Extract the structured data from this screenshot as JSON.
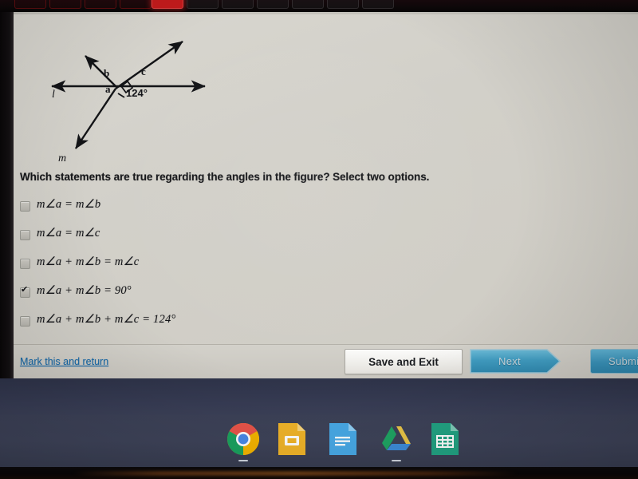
{
  "figure": {
    "name": "angle-figure",
    "line_labels": {
      "horizontal": "l",
      "diagonal": "m"
    },
    "angle_labels": {
      "a": "a",
      "b": "b",
      "c": "c"
    },
    "given_angle": "124°",
    "right_angle_marker": "right-angle-square"
  },
  "question": {
    "prefix": "Which statements are true regarding the angles in the figure? Select ",
    "emphasis": "two",
    "suffix": " options."
  },
  "options": [
    {
      "id": "opt-1",
      "label": "m∠a = m∠b",
      "checked": false
    },
    {
      "id": "opt-2",
      "label": "m∠a = m∠c",
      "checked": false
    },
    {
      "id": "opt-3",
      "label": "m∠a + m∠b = m∠c",
      "checked": false
    },
    {
      "id": "opt-4",
      "label": "m∠a + m∠b = 90°",
      "checked": true
    },
    {
      "id": "opt-5",
      "label": "m∠a + m∠b + m∠c = 124°",
      "checked": false
    }
  ],
  "actionbar": {
    "mark_link": "Mark this and return",
    "save_label": "Save and Exit",
    "next_label": "Next",
    "submit_label": "Submit"
  },
  "shelf": {
    "icons": [
      {
        "name": "chrome-icon",
        "label": "Chrome"
      },
      {
        "name": "google-slides-icon",
        "label": "Slides"
      },
      {
        "name": "google-docs-icon",
        "label": "Docs"
      },
      {
        "name": "google-drive-icon",
        "label": "Drive"
      },
      {
        "name": "google-sheets-icon",
        "label": "Sheets"
      }
    ]
  },
  "colors": {
    "page_bg": "#d4d2cb",
    "link_blue": "#1769a8",
    "next_teal": "#3a93ba",
    "submit_teal": "#2d84ab",
    "keyboard_red": "#c21b1c"
  }
}
